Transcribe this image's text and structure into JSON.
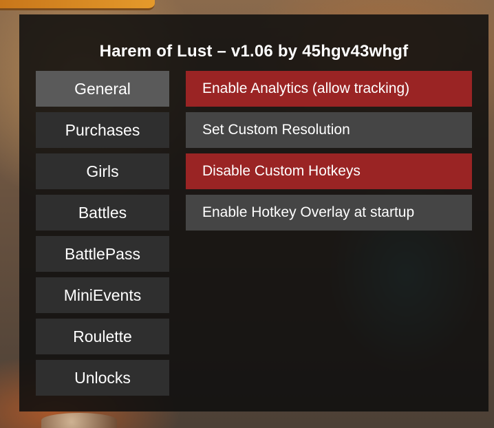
{
  "title": "Harem of Lust – v1.06 by 45hgv43whgf",
  "tabs": [
    {
      "label": "General",
      "active": true
    },
    {
      "label": "Purchases",
      "active": false
    },
    {
      "label": "Girls",
      "active": false
    },
    {
      "label": "Battles",
      "active": false
    },
    {
      "label": "BattlePass",
      "active": false
    },
    {
      "label": "MiniEvents",
      "active": false
    },
    {
      "label": "Roulette",
      "active": false
    },
    {
      "label": "Unlocks",
      "active": false
    }
  ],
  "options": [
    {
      "label": "Enable Analytics (allow tracking)",
      "style": "red"
    },
    {
      "label": "Set Custom Resolution",
      "style": "gray"
    },
    {
      "label": "Disable Custom Hotkeys",
      "style": "red"
    },
    {
      "label": "Enable Hotkey Overlay at startup",
      "style": "gray"
    }
  ],
  "colors": {
    "panel_bg": "#0e0e0e",
    "tab_bg": "#2f2f2f",
    "tab_active_bg": "#5a5a5a",
    "option_gray": "#454545",
    "option_red": "#9a2424",
    "text": "#ffffff"
  }
}
